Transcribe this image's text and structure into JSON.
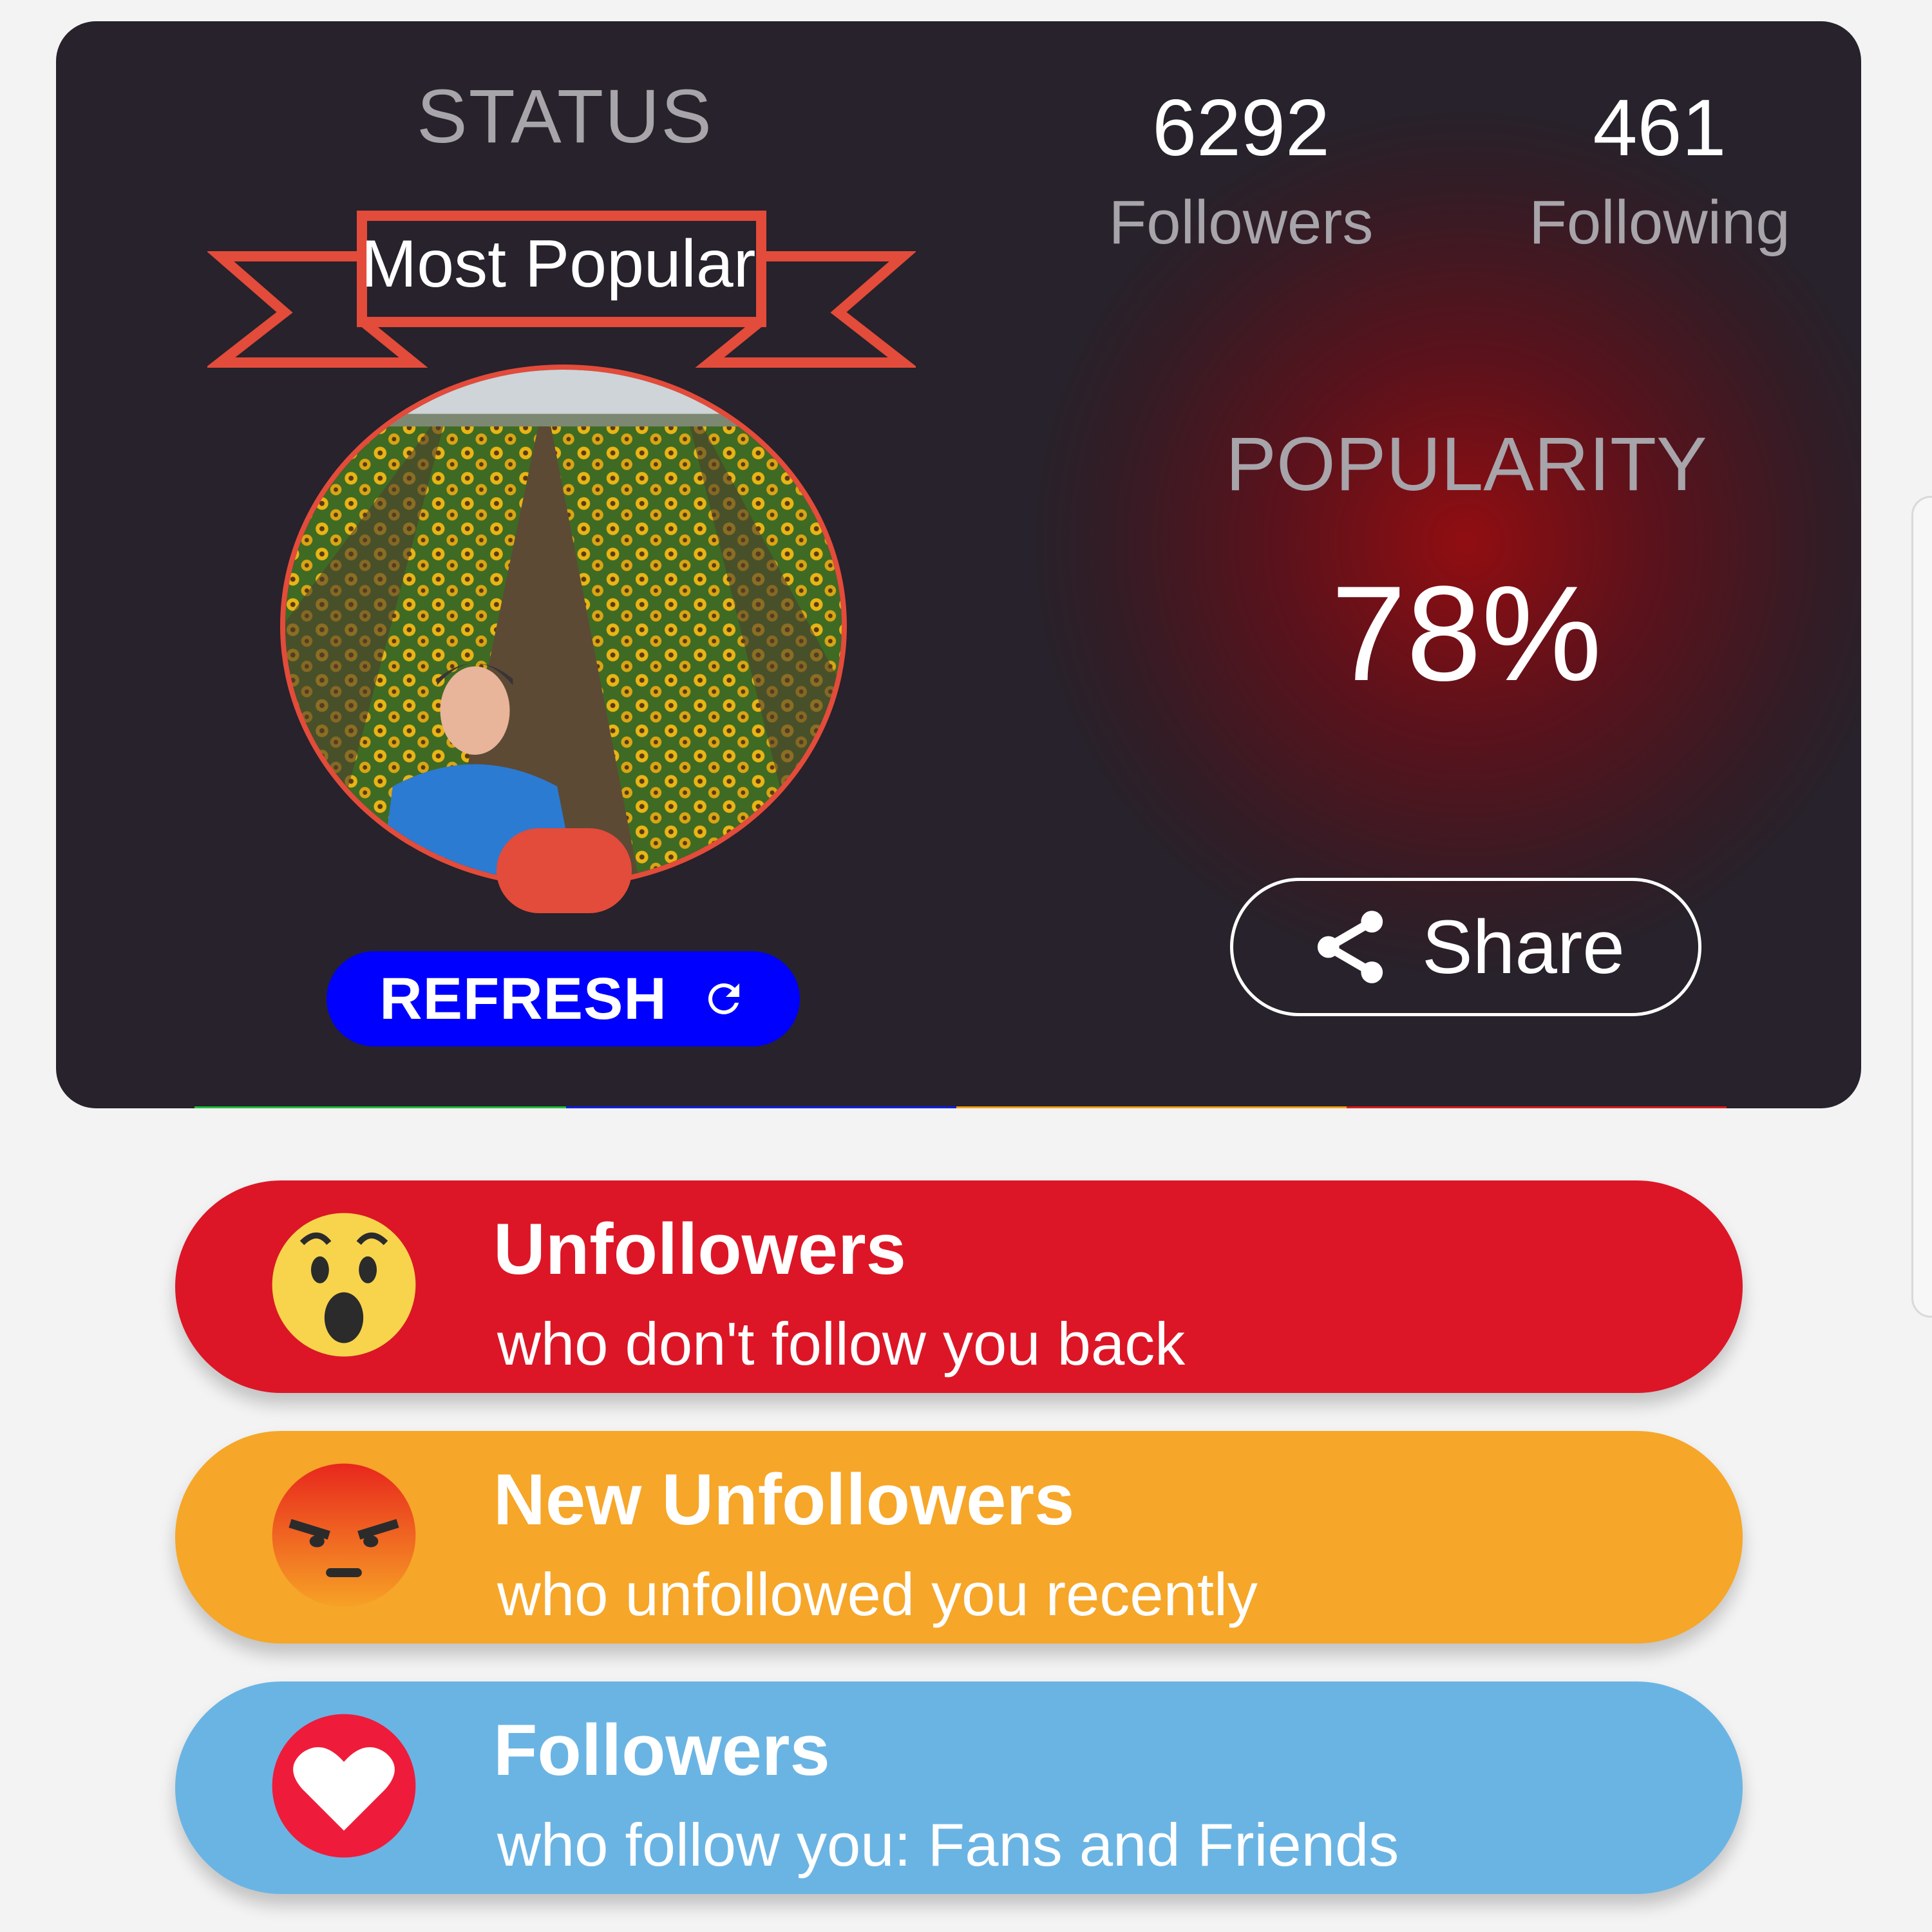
{
  "status": {
    "title": "STATUS",
    "badge": "Most Popular",
    "refresh_label": "REFRESH"
  },
  "stats": {
    "followers_value": "6292",
    "followers_label": "Followers",
    "following_value": "461",
    "following_label": "Following"
  },
  "popularity": {
    "title": "POPULARITY",
    "value": "78%",
    "share_label": "Share"
  },
  "accent_colors": {
    "card_bg": "#27222b",
    "ribbon": "#e34b3a",
    "refresh": "#0000ff",
    "bar": [
      "#1fc23a",
      "#0d1fe8",
      "#f5a418",
      "#e01a1a"
    ]
  },
  "menu": [
    {
      "icon": "surprised-face-icon",
      "title": "Unfollowers",
      "subtitle": "who don't follow you back",
      "color": "#dc1626"
    },
    {
      "icon": "angry-face-icon",
      "title": "New Unfollowers",
      "subtitle": "who unfollowed you recently",
      "color": "#f6a628"
    },
    {
      "icon": "heart-icon",
      "title": "Followers",
      "subtitle": "who follow you: Fans and Friends",
      "color": "#6ab4e4"
    }
  ]
}
